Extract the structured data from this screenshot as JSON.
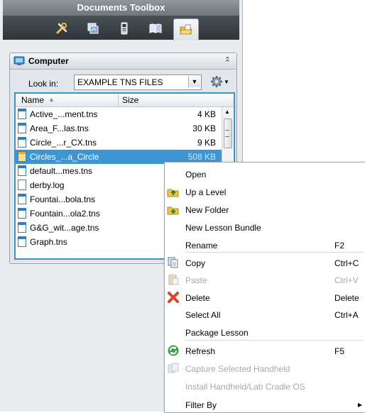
{
  "panel": {
    "title": "Documents Toolbox",
    "tabs": [
      {
        "name": "tools-tab",
        "icon": "tools-icon"
      },
      {
        "name": "page-sorter-tab",
        "icon": "page-sorter-icon"
      },
      {
        "name": "emulator-tab",
        "icon": "handheld-icon"
      },
      {
        "name": "content-tab",
        "icon": "book-icon"
      },
      {
        "name": "content-explorer-tab",
        "icon": "folder-icon",
        "active": true
      }
    ]
  },
  "section": {
    "title": "Computer",
    "collapse_symbol": "⌃",
    "look_in_label": "Look in:",
    "look_in_value": "EXAMPLE TNS FILES"
  },
  "columns": {
    "name": "Name",
    "size": "Size"
  },
  "files": [
    {
      "name": "Active_...ment.tns",
      "size": "4 KB"
    },
    {
      "name": "Area_F...las.tns",
      "size": "30 KB"
    },
    {
      "name": "Circle_...r_CX.tns",
      "size": "9 KB"
    },
    {
      "name": "Circles_...a_Circle",
      "size": "508 KB",
      "selected": true
    },
    {
      "name": "default...mes.tns",
      "size": ""
    },
    {
      "name": "derby.log",
      "size": ""
    },
    {
      "name": "Fountai...bola.tns",
      "size": ""
    },
    {
      "name": "Fountain...ola2.tns",
      "size": ""
    },
    {
      "name": "G&G_wit...age.tns",
      "size": ""
    },
    {
      "name": "Graph.tns",
      "size": ""
    }
  ],
  "menu": [
    {
      "label": "Open",
      "shortcut": "",
      "icon": "",
      "disabled": false
    },
    {
      "label": "Up a Level",
      "shortcut": "",
      "icon": "up-level-icon",
      "disabled": false
    },
    {
      "label": "New Folder",
      "shortcut": "",
      "icon": "new-folder-icon",
      "disabled": false
    },
    {
      "label": "New Lesson Bundle",
      "shortcut": "",
      "icon": "",
      "disabled": false
    },
    {
      "label": "Rename",
      "shortcut": "F2",
      "icon": "",
      "disabled": false
    },
    {
      "label": "Copy",
      "shortcut": "Ctrl+C",
      "icon": "copy-icon",
      "disabled": false
    },
    {
      "label": "Paste",
      "shortcut": "Ctrl+V",
      "icon": "paste-icon",
      "disabled": true
    },
    {
      "label": "Delete",
      "shortcut": "Delete",
      "icon": "delete-icon",
      "disabled": false
    },
    {
      "label": "Select All",
      "shortcut": "Ctrl+A",
      "icon": "",
      "disabled": false
    },
    {
      "label": "Package Lesson",
      "shortcut": "",
      "icon": "",
      "disabled": false
    },
    {
      "label": "Refresh",
      "shortcut": "F5",
      "icon": "refresh-icon",
      "disabled": false
    },
    {
      "label": "Capture Selected Handheld",
      "shortcut": "",
      "icon": "capture-icon",
      "disabled": true
    },
    {
      "label": "Install Handheld/Lab Cradle OS",
      "shortcut": "",
      "icon": "",
      "disabled": true
    },
    {
      "label": "Filter By",
      "shortcut": "",
      "icon": "",
      "disabled": false,
      "submenu": true
    }
  ],
  "colors": {
    "accent": "#3d96d3",
    "titlebar": "#7d848a",
    "tabbar": "#3a3f44"
  }
}
